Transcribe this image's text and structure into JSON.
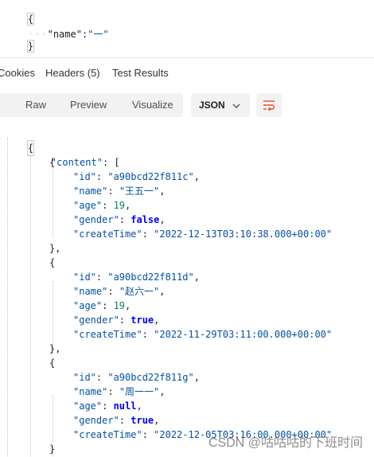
{
  "request_body": {
    "open": "{",
    "key": "\"name\"",
    "colon": ":",
    "value": "\"一\"",
    "close": "}",
    "dots": "···"
  },
  "response_tabs": [
    "Cookies",
    "Headers (5)",
    "Test Results"
  ],
  "toolbar": {
    "views": [
      "Raw",
      "Preview",
      "Visualize"
    ],
    "format": "JSON",
    "format_icon": "chevron-down-icon",
    "wrap_icon": "wrap-lines-icon",
    "wrap_color": "#e5532d"
  },
  "response": {
    "open": "{",
    "content_key": "\"content\"",
    "array_open": "[",
    "items": [
      {
        "id": "\"a90bcd22f811c\"",
        "name": "\"王五一\"",
        "age": "19",
        "age_type": "num",
        "gender": "false",
        "createTime": "\"2022-12-13T03:10:38.000+00:00\"",
        "close": "},"
      },
      {
        "id": "\"a90bcd22f811d\"",
        "name": "\"赵六一\"",
        "age": "19",
        "age_type": "num",
        "gender": "true",
        "createTime": "\"2022-11-29T03:11:00.000+00:00\"",
        "close": "},"
      },
      {
        "id": "\"a90bcd22f811g\"",
        "name": "\"周一一\"",
        "age": "null",
        "age_type": "kw",
        "gender": "true",
        "createTime": "\"2022-12-05T03:16:00.000+00:00\"",
        "close": "}"
      }
    ],
    "labels": {
      "id": "\"id\"",
      "name": "\"name\"",
      "age": "\"age\"",
      "gender": "\"gender\"",
      "createTime": "\"createTime\""
    }
  },
  "watermark": "CSDN @咕咕咕的下班时间"
}
